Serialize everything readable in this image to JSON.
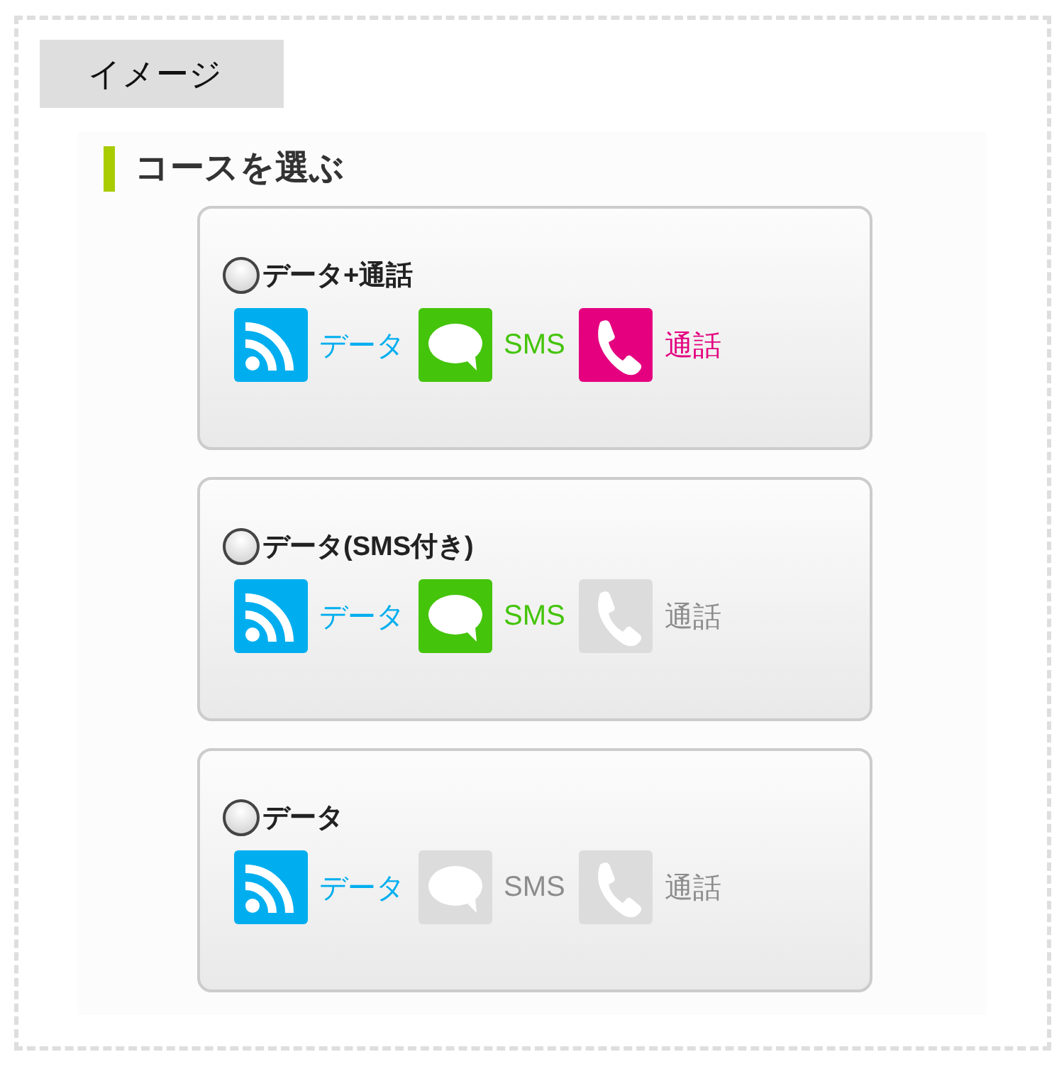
{
  "label": "イメージ",
  "heading": "コースを選ぶ",
  "courses": [
    {
      "name": "データ+通話",
      "selected": false,
      "features": [
        {
          "kind": "data",
          "label": "データ",
          "on": true
        },
        {
          "kind": "sms",
          "label": "SMS",
          "on": true
        },
        {
          "kind": "call",
          "label": "通話",
          "on": true
        }
      ]
    },
    {
      "name": "データ(SMS付き)",
      "selected": false,
      "features": [
        {
          "kind": "data",
          "label": "データ",
          "on": true
        },
        {
          "kind": "sms",
          "label": "SMS",
          "on": true
        },
        {
          "kind": "call",
          "label": "通話",
          "on": false
        }
      ]
    },
    {
      "name": "データ",
      "selected": false,
      "features": [
        {
          "kind": "data",
          "label": "データ",
          "on": true
        },
        {
          "kind": "sms",
          "label": "SMS",
          "on": false
        },
        {
          "kind": "call",
          "label": "通話",
          "on": false
        }
      ]
    }
  ]
}
